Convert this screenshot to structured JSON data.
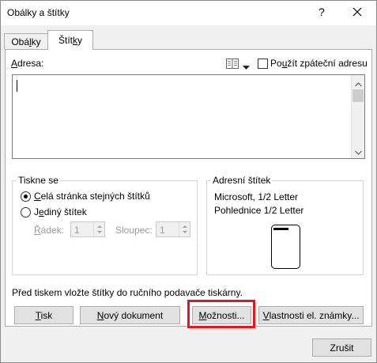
{
  "window": {
    "title": "Obálky a štítky",
    "help": "?"
  },
  "tabs": [
    {
      "pre": "Obá",
      "acc": "l",
      "post": "ky",
      "active": false
    },
    {
      "pre": "Štít",
      "acc": "k",
      "post": "y",
      "active": true
    }
  ],
  "address": {
    "label_acc": "A",
    "label_post": "dresa:",
    "return_pre": "Po",
    "return_acc": "u",
    "return_post": "žít zpáteční adresu",
    "return_checked": false,
    "value": ""
  },
  "print": {
    "legend": "Tiskne se",
    "full_acc": "C",
    "full_post": "elá stránka stejných štítků",
    "full_selected": true,
    "single_pre": "J",
    "single_acc": "e",
    "single_post": "diný štítek",
    "single_selected": false,
    "row_label_acc": "Ř",
    "row_label_post": "ádek:",
    "row_value": "1",
    "col_label": "Sloupec:",
    "col_value": "1"
  },
  "label": {
    "legend": "Adresní štítek",
    "line1": "Microsoft, 1/2 Letter",
    "line2": "Pohlednice 1/2 Letter"
  },
  "note": "Před tiskem vložte štítky do ručního podavače tiskárny.",
  "buttons": {
    "print_acc": "T",
    "print_post": "isk",
    "newdoc_acc": "N",
    "newdoc_post": "ový dokument",
    "options_acc": "M",
    "options_post": "ožnosti...",
    "props_acc": "V",
    "props_post": "lastnosti el. známky...",
    "cancel": "Zrušit"
  },
  "colors": {
    "highlight": "#e8141e"
  }
}
